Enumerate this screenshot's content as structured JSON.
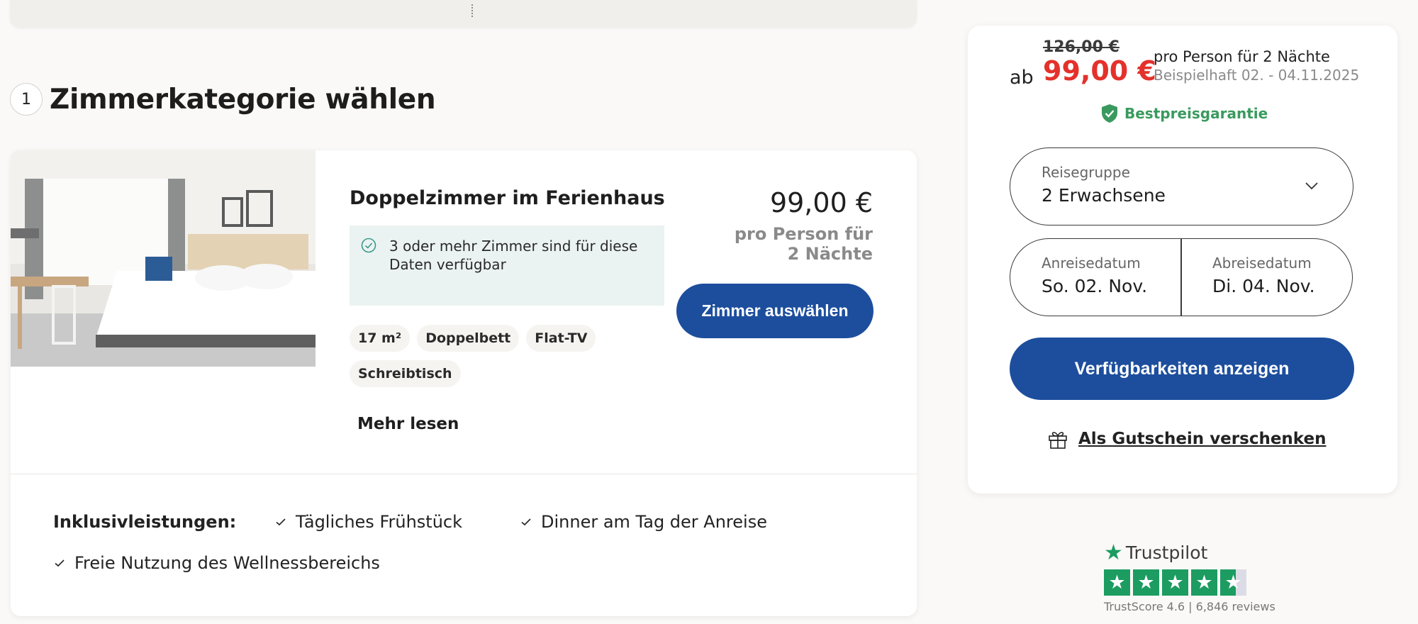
{
  "section": {
    "step": "1",
    "title": "Zimmerkategorie wählen"
  },
  "room": {
    "title": "Doppelzimmer im Ferienhaus",
    "availability": "3 oder mehr Zimmer sind für diese Daten verfügbar",
    "features": [
      "17 m²",
      "Doppelbett",
      "Flat-TV",
      "Schreibtisch"
    ],
    "more_label": "Mehr lesen",
    "price": "99,00 €",
    "price_note": "pro Person für 2 Nächte",
    "select_label": "Zimmer auswählen",
    "inclusive_label": "Inklusivleistungen:",
    "inclusives": [
      "Tägliches Frühstück",
      "Dinner am Tag der Anreise",
      "Freie Nutzung des Wellnessbereichs"
    ]
  },
  "booking": {
    "old_price": "126,00 €",
    "prefix": "ab",
    "price": "99,00 €",
    "per_person": "pro Person für 2 Nächte",
    "example_dates": "Beispielhaft 02. - 04.11.2025",
    "guarantee": "Bestpreisgarantie",
    "travel_group_label": "Reisegruppe",
    "travel_group_value": "2 Erwachsene",
    "arrival_label": "Anreisedatum",
    "arrival_value": "So. 02. Nov.",
    "departure_label": "Abreisedatum",
    "departure_value": "Di. 04. Nov.",
    "availability_button": "Verfügbarkeiten anzeigen",
    "voucher_link": "Als Gutschein verschenken"
  },
  "trustpilot": {
    "brand": "Trustpilot",
    "rating_fraction": 0.92,
    "score_text": "TrustScore 4.6 | 6,846 reviews"
  },
  "colors": {
    "primary": "#1d4e9d",
    "sale": "#e4312b",
    "guarantee": "#3a9a5e",
    "trust": "#1c9c61",
    "availability_bg": "#ebf3f2"
  }
}
